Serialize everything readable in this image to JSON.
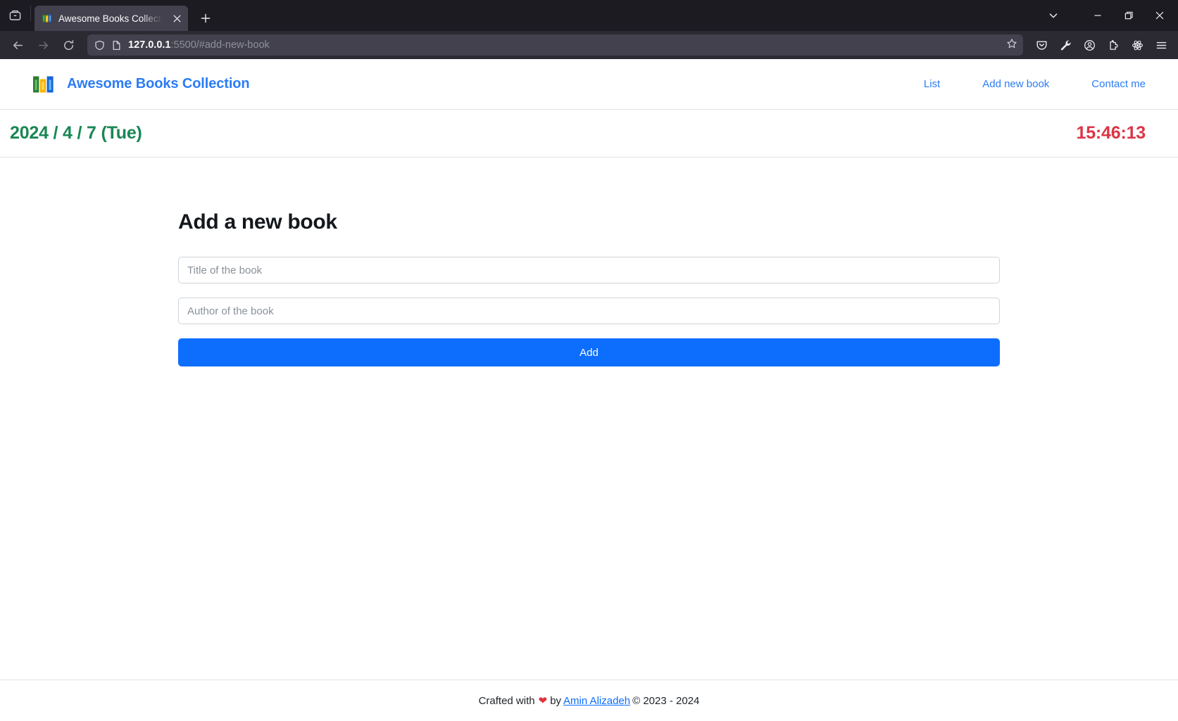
{
  "browser": {
    "sidebar_icon": "library-icon",
    "tab": {
      "title": "Awesome Books Collecti",
      "favicon": "books-icon",
      "close_label": "×"
    },
    "new_tab_label": "+",
    "window_controls": {
      "list_tabs": "chevron-down-icon",
      "minimize": "—",
      "maximize": "maximize-icon",
      "close": "×"
    },
    "nav": {
      "back": "back-arrow-icon",
      "forward": "forward-arrow-icon",
      "reload": "reload-icon"
    },
    "url": {
      "host": "127.0.0.1",
      "path": ":5500/#add-new-book",
      "full": "127.0.0.1:5500/#add-new-book",
      "shield_icon": "shield-icon",
      "page_icon": "page-icon",
      "bookmark_icon": "star-icon"
    },
    "toolbar_icons": [
      "pocket-icon",
      "wrench-icon",
      "account-icon",
      "extensions-icon",
      "react-devtools-icon",
      "hamburger-menu-icon"
    ]
  },
  "site": {
    "brand": {
      "name": "Awesome Books Collection",
      "logo": "books-logo"
    },
    "nav_links": [
      {
        "label": "List"
      },
      {
        "label": "Add new book"
      },
      {
        "label": "Contact me"
      }
    ],
    "datebar": {
      "date": "2024 / 4 / 7 (Tue)",
      "time": "15:46:13",
      "date_color": "#198754",
      "time_color": "#dc3545"
    },
    "form": {
      "title": "Add a new book",
      "title_input": {
        "value": "",
        "placeholder": "Title of the book"
      },
      "author_input": {
        "value": "",
        "placeholder": "Author of the book"
      },
      "submit_label": "Add",
      "submit_color": "#0d6efd"
    },
    "footer": {
      "prefix": "Crafted with",
      "heart": "❤",
      "by": "by",
      "author": "Amin Alizadeh",
      "copyright": "© 2023 - 2024"
    }
  }
}
